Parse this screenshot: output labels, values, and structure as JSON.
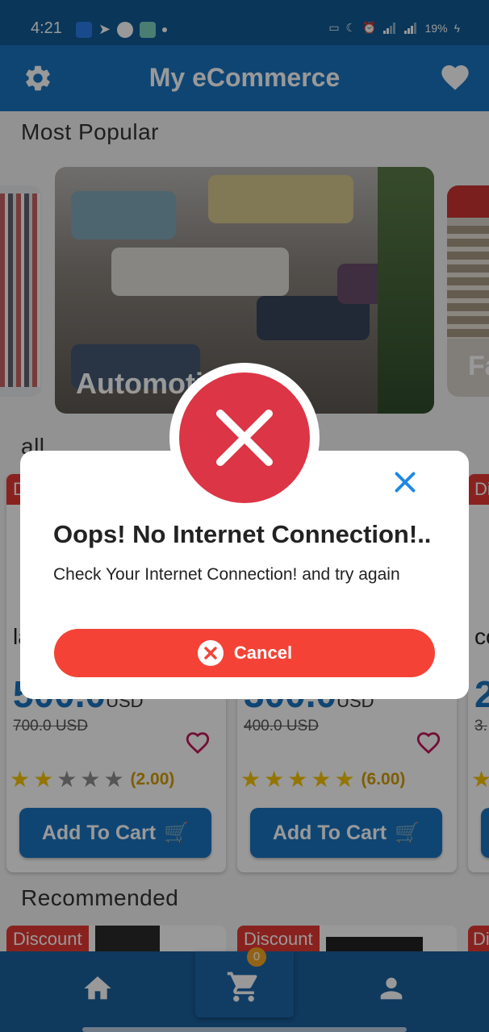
{
  "status_bar": {
    "time": "4:21",
    "battery": "19%"
  },
  "app_bar": {
    "title": "My eCommerce"
  },
  "sections": {
    "most_popular": "Most Popular",
    "all": "all",
    "recommended": "Recommended"
  },
  "carousel": {
    "main_label": "Automoti",
    "right_label": "Fa"
  },
  "products": [
    {
      "badge": "D",
      "title": "la",
      "price": "500.0",
      "currency": "USD",
      "old_price": "700.0 USD",
      "stars_filled": 2,
      "stars_total": 5,
      "rating": "(2.00)",
      "button": "Add To Cart"
    },
    {
      "badge": "",
      "title": "",
      "price": "300.0",
      "currency": "USD",
      "old_price": "400.0 USD",
      "stars_filled": 5,
      "stars_total": 5,
      "rating": "(6.00)",
      "button": "Add To Cart"
    },
    {
      "badge": "Di",
      "title": "co",
      "price": "2",
      "old_price": "3."
    }
  ],
  "recommended": [
    {
      "badge": "Discount"
    },
    {
      "badge": "Discount"
    },
    {
      "badge": "Di"
    }
  ],
  "dialog": {
    "title": "Oops! No Internet Connection!..",
    "message": "Check Your Internet Connection! and try again",
    "cancel_label": "Cancel"
  },
  "bottom_nav": {
    "cart_count": "0"
  },
  "colors": {
    "primary": "#1a73c0",
    "error": "#dc3545",
    "cancel": "#f44336",
    "star": "#f7c400",
    "badge": "#e53935"
  }
}
